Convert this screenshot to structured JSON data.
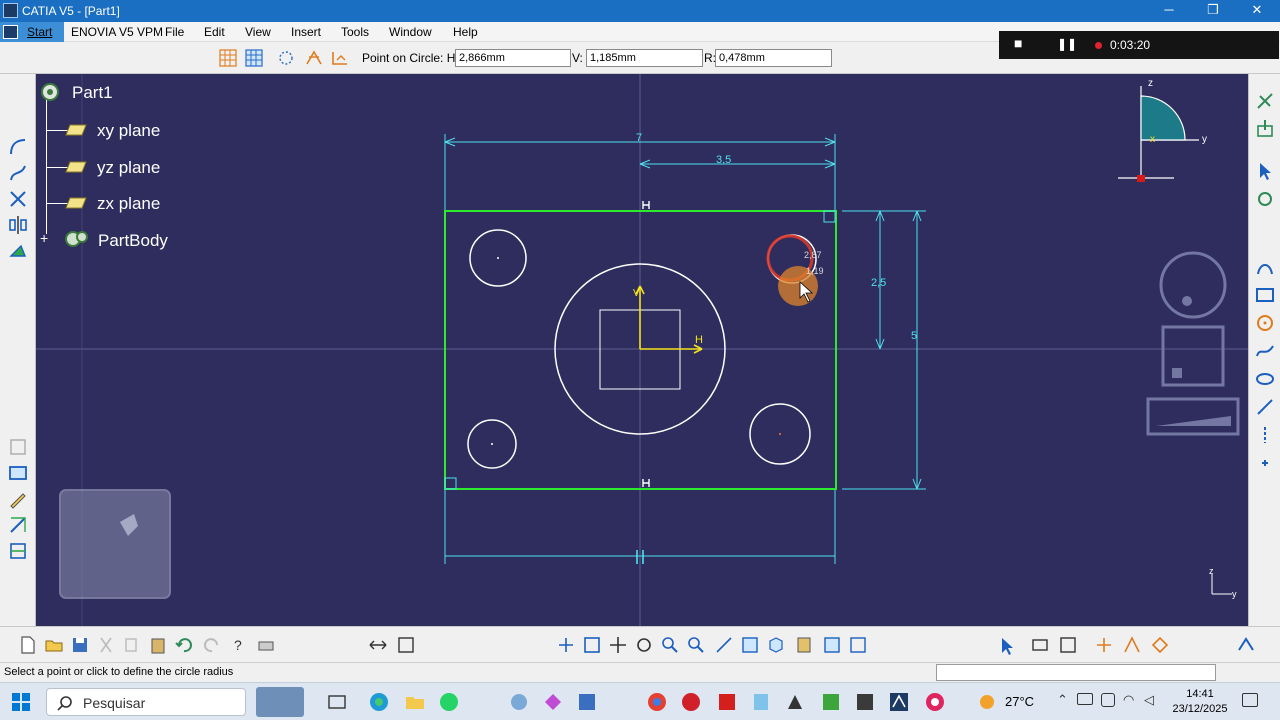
{
  "window": {
    "title": "CATIA V5 - [Part1]",
    "minimize_glyph": "─",
    "maximize_glyph": "❐",
    "close_glyph": "✕"
  },
  "menu": {
    "start": "Start",
    "items": [
      "ENOVIA V5 VPM",
      "File",
      "Edit",
      "View",
      "Insert",
      "Tools",
      "Window",
      "Help"
    ]
  },
  "sketch_tools": {
    "label": "Point on Circle: H:",
    "h_value": "2,866mm",
    "v_label": "V:",
    "v_value": "1,185mm",
    "r_label": "R:",
    "r_value": "0,478mm"
  },
  "recorder": {
    "time": "0:03:20",
    "stop_glyph": "■",
    "pause_glyph": "❚❚"
  },
  "tree": {
    "root": "Part1",
    "items": [
      "xy plane",
      "yz plane",
      "zx plane",
      "PartBody"
    ],
    "expand_glyph": "+"
  },
  "sketch": {
    "dim_total_width": "7",
    "dim_half_width": "3,5",
    "dim_half_height": "2,5",
    "dim_total_height": "5",
    "axis_h": "H",
    "axis_v": "V",
    "cursor_hint_1": "2,87",
    "cursor_hint_2": "1,19",
    "compass_z": "z",
    "compass_x": "x",
    "compass_y": "y",
    "corner_z": "z",
    "corner_y": "y"
  },
  "status": {
    "message": "Select a point or click to define the circle radius"
  },
  "taskbar": {
    "search": "Pesquisar",
    "temperature": "27°C",
    "time": "14:41",
    "date": "23/12/2025"
  },
  "colors": {
    "sketch_bg": "#2e2d5e",
    "profile": "#2eea2e",
    "dimension": "#4fe0ee",
    "geometry": "#ffffff",
    "axis": "#f6e21c"
  },
  "icons": [
    "windows-start-icon",
    "search-icon",
    "task-view-icon",
    "edge-icon",
    "folder-icon",
    "whatsapp-icon",
    "chrome-icon",
    "catia-icon"
  ]
}
